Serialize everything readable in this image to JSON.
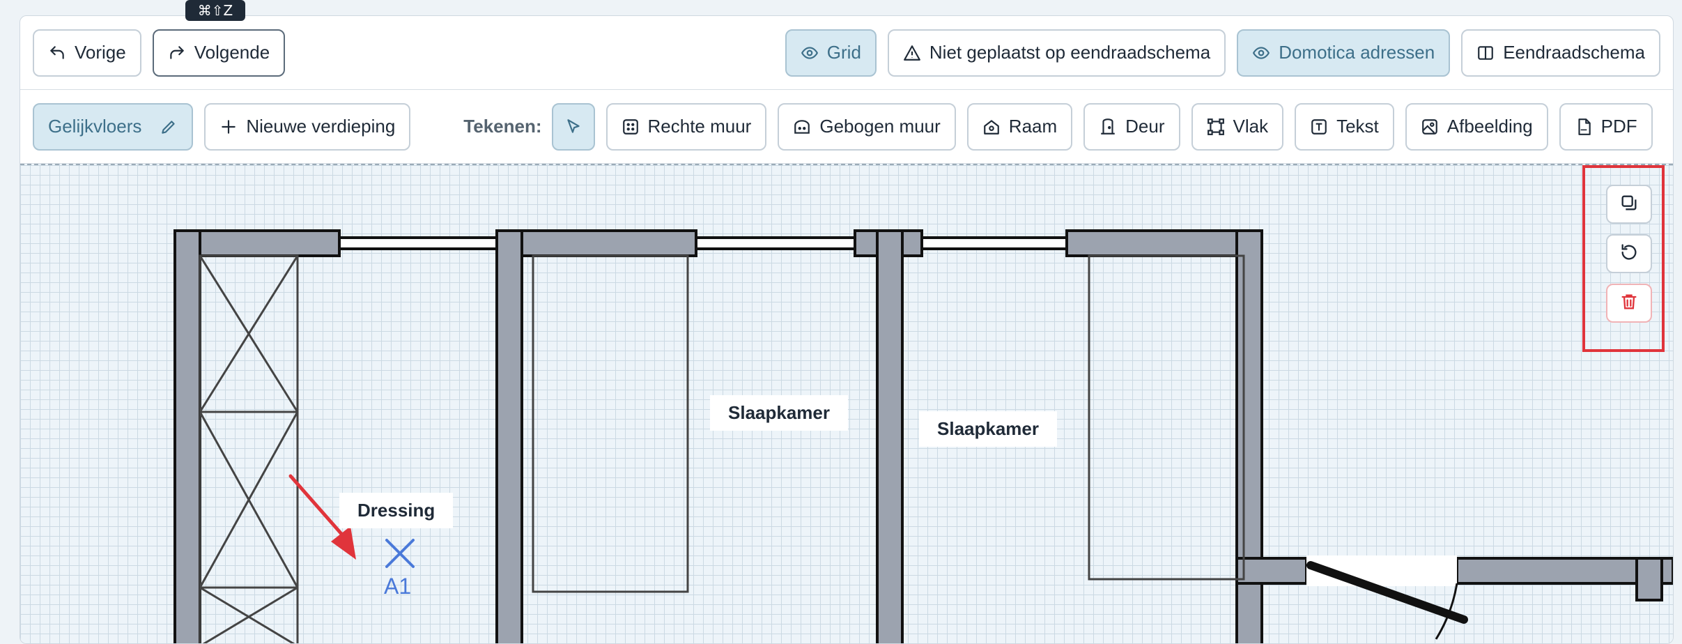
{
  "tooltip": "⌘⇧Z",
  "top_toolbar": {
    "undo_label": "Vorige",
    "redo_label": "Volgende",
    "grid_label": "Grid",
    "not_placed_label": "Niet geplaatst op eendraadschema",
    "domotica_label": "Domotica adressen",
    "eendraad_label": "Eendraadschema"
  },
  "draw_toolbar": {
    "floor_label": "Gelijkvloers",
    "new_floor_label": "Nieuwe verdieping",
    "draw_label": "Tekenen:",
    "tools": {
      "straight_wall": "Rechte muur",
      "curved_wall": "Gebogen muur",
      "window": "Raam",
      "door": "Deur",
      "area": "Vlak",
      "text": "Tekst",
      "image": "Afbeelding",
      "pdf": "PDF"
    }
  },
  "canvas": {
    "rooms": {
      "dressing": "Dressing",
      "bedroom1": "Slaapkamer",
      "bedroom2": "Slaapkamer"
    },
    "marker_label": "A1"
  },
  "colors": {
    "active_button_bg": "#d7e9f2",
    "active_button_text": "#3d6f89",
    "wall_fill": "#9ca3af",
    "marker": "#4a79d9",
    "highlight": "#e0343b"
  },
  "side_tools_icons": [
    "duplicate-icon",
    "rotate-icon",
    "trash-icon"
  ]
}
